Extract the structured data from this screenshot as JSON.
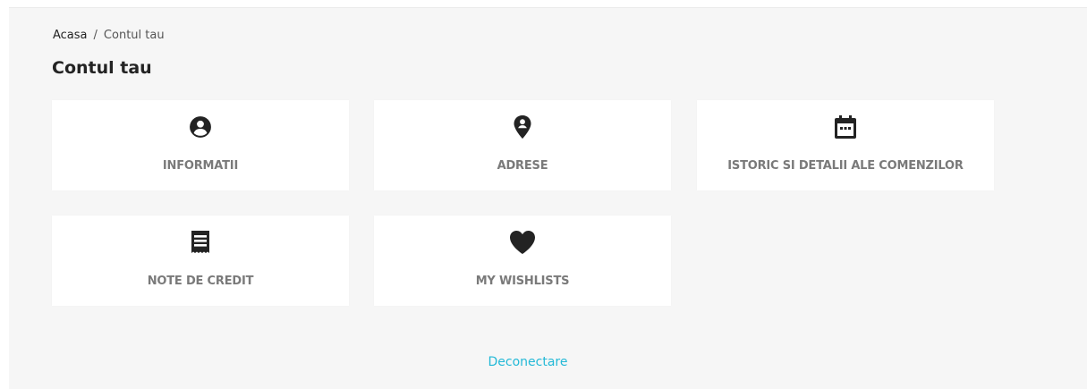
{
  "breadcrumb": {
    "home": "Acasa",
    "separator": "/",
    "current": "Contul tau"
  },
  "page_title": "Contul tau",
  "tiles": [
    {
      "label": "INFORMATII",
      "icon": "account-circle-icon"
    },
    {
      "label": "ADRESE",
      "icon": "location-pin-icon"
    },
    {
      "label": "ISTORIC SI DETALII ALE COMENZILOR",
      "icon": "calendar-icon"
    },
    {
      "label": "NOTE DE CREDIT",
      "icon": "receipt-icon"
    },
    {
      "label": "MY WISHLISTS",
      "icon": "heart-icon"
    }
  ],
  "logout_label": "Deconectare",
  "colors": {
    "background": "#f6f6f6",
    "tile": "#ffffff",
    "icon": "#232323",
    "tile_label": "#7a7a7a",
    "link": "#24b9d7"
  }
}
